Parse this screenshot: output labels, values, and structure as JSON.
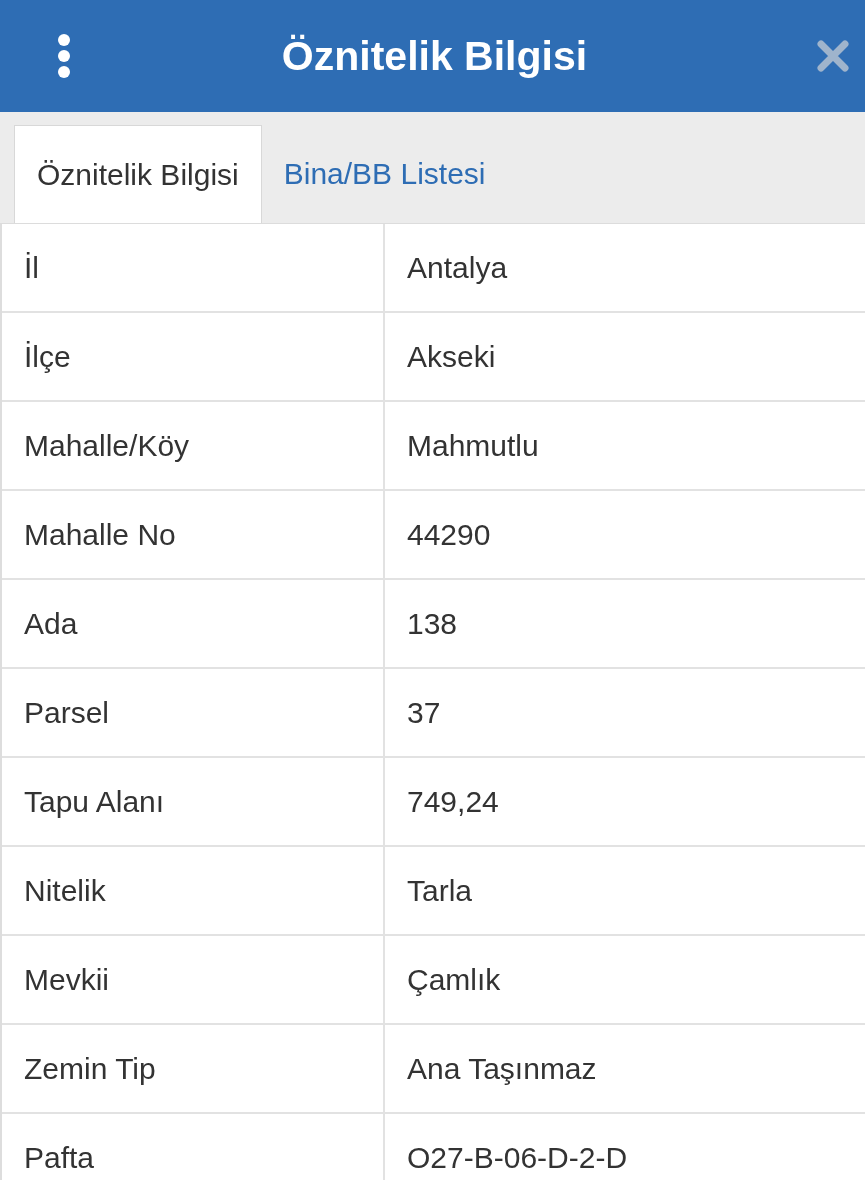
{
  "header": {
    "title": "Öznitelik Bilgisi"
  },
  "tabs": [
    {
      "label": "Öznitelik Bilgisi",
      "selected": true
    },
    {
      "label": "Bina/BB Listesi",
      "selected": false
    }
  ],
  "table": {
    "rows": [
      {
        "label": "İl",
        "value": "Antalya"
      },
      {
        "label": "İlçe",
        "value": "Akseki"
      },
      {
        "label": "Mahalle/Köy",
        "value": "Mahmutlu"
      },
      {
        "label": "Mahalle No",
        "value": "44290"
      },
      {
        "label": "Ada",
        "value": "138"
      },
      {
        "label": "Parsel",
        "value": "37"
      },
      {
        "label": "Tapu Alanı",
        "value": "749,24"
      },
      {
        "label": "Nitelik",
        "value": "Tarla"
      },
      {
        "label": "Mevkii",
        "value": "Çamlık"
      },
      {
        "label": "Zemin Tip",
        "value": "Ana Taşınmaz"
      },
      {
        "label": "Pafta",
        "value": "O27-B-06-D-2-D"
      }
    ]
  }
}
